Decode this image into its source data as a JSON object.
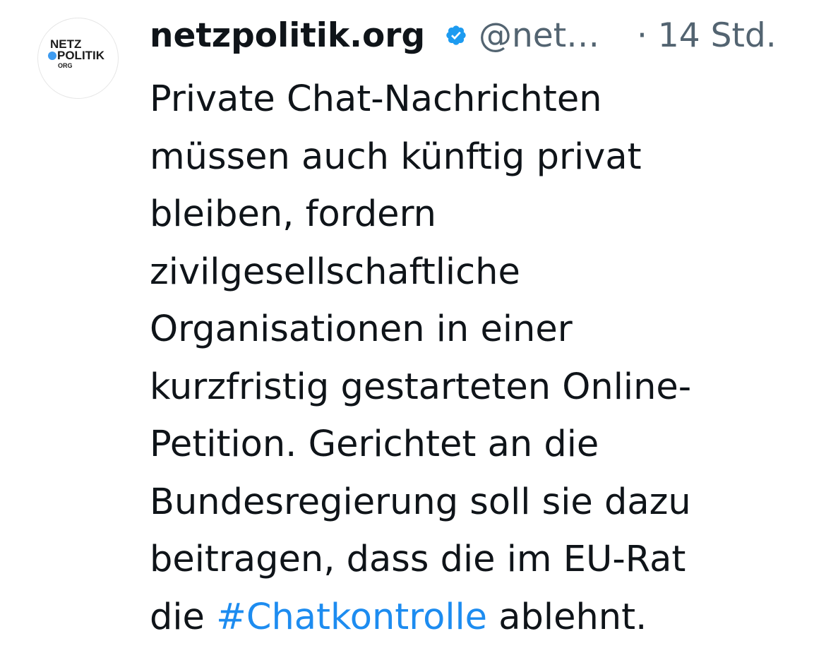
{
  "post": {
    "avatar": {
      "logo_line1": "NETZ",
      "logo_line2": "POLITIK",
      "logo_line3": "ORG",
      "accent_color": "#3d9bf0"
    },
    "author_name": "netzpolitik.org",
    "verified_icon": "verified-badge-icon",
    "handle": "@net…",
    "timestamp": "· 14 Std.",
    "text": {
      "line1": "Private Chat-Nachrichten",
      "line2": "müssen auch künftig privat",
      "line3": "bleiben, fordern",
      "line4": "zivilgesellschaftliche",
      "line5": "Organisationen in einer",
      "line6": "kurzfristig gestarteten Online-",
      "line7": "Petition. Gerichtet an die",
      "line8": "Bundesregierung soll sie dazu",
      "line9": "beitragen, dass die im EU-Rat",
      "line10_prefix": "die ",
      "hashtag": "#Chatkontrolle",
      "line10_suffix": " ablehnt."
    },
    "colors": {
      "text": "#0f1419",
      "secondary": "#536471",
      "link": "#1d8cf0",
      "verified": "#1d9bf0"
    }
  }
}
